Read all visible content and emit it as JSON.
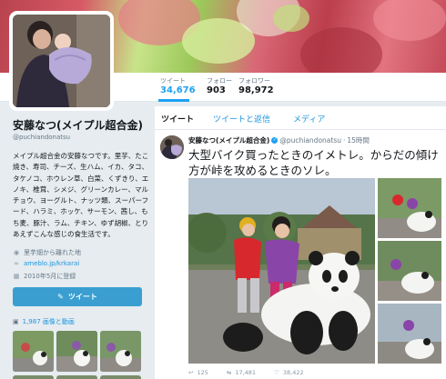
{
  "profile": {
    "display_name": "安藤なつ(メイプル超合金)",
    "handle": "@puchiandonatsu",
    "bio": "メイプル超合金の安藤なつです。里芋、たこ焼き、寿司、チーズ、生ハム、イカ、タコ、タケノコ、ホウレン草、白菜、くずきり、エノキ、椎茸、シメジ、グリーンカレー、マルチョウ、ヨーグルト、ナッツ類、スーパーフード、ハラミ、ホッケ、サーモン、茜し、もち麦、豚汁、ラム、チキン、ゆず胡椒、とりあえずこんな感じの食生活です。",
    "location": "里芋畑から離れた地",
    "website": "ameblo.jp/krkarai",
    "joined": "2010年5月に登録",
    "tweet_button_label": "ツイート",
    "media_label": "1,987 画像と動画",
    "location_icon": "map-pin-icon",
    "link_icon": "link-icon",
    "calendar_icon": "calendar-icon"
  },
  "stats": [
    {
      "label": "ツイート",
      "value": "34,676"
    },
    {
      "label": "フォロー",
      "value": "903"
    },
    {
      "label": "フォロワー",
      "value": "98,972"
    }
  ],
  "timeline": {
    "tabs": [
      "ツイート",
      "ツイートと返信",
      "メディア"
    ]
  },
  "tweet": {
    "name": "安藤なつ(メイプル超合金)",
    "handle": "@puchiandonatsu",
    "time": "15時間",
    "text": "大型バイク買ったときのイメトレ。からだの傾け方が峠を攻めるときのソレ。",
    "reply_count": "125",
    "retweet_count": "17,481",
    "like_count": "38,422"
  },
  "colors": {
    "accent": "#1da1f2",
    "link": "#1b95e0",
    "tweet_button": "#3a9fd0",
    "background": "#e6ecf0"
  }
}
